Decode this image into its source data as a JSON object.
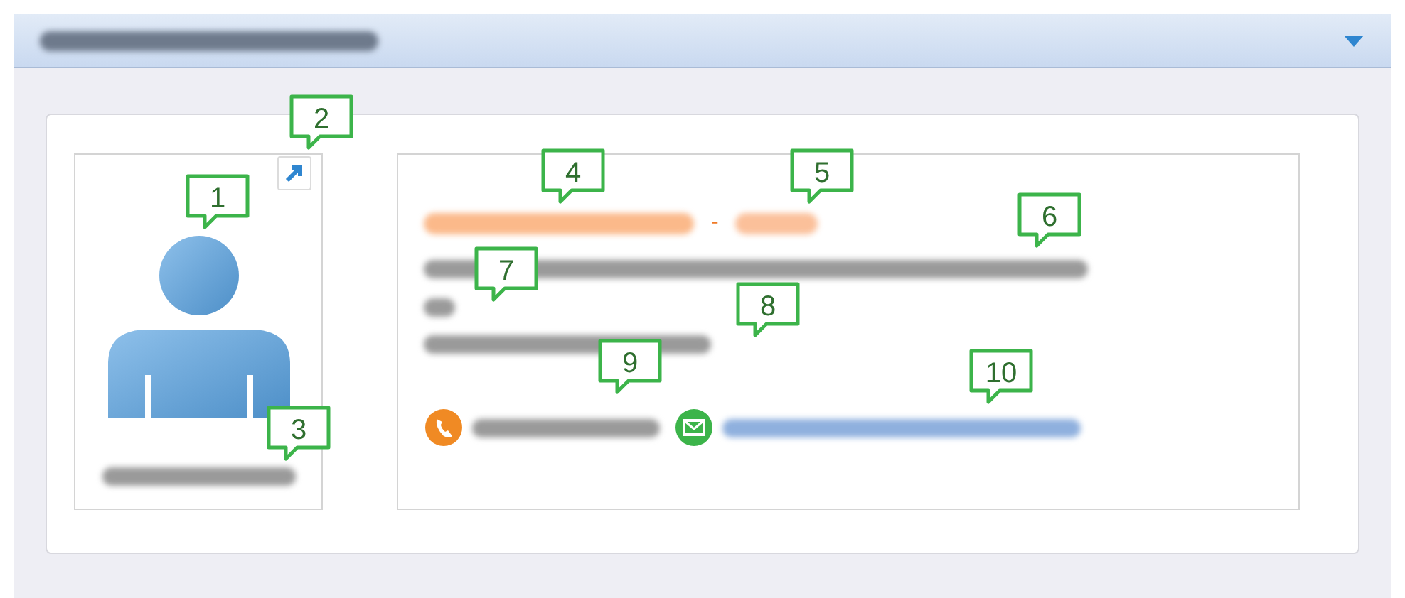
{
  "contact": {
    "separator": "-"
  },
  "callouts": [
    {
      "label": "1"
    },
    {
      "label": "2"
    },
    {
      "label": "3"
    },
    {
      "label": "4"
    },
    {
      "label": "5"
    },
    {
      "label": "6"
    },
    {
      "label": "7"
    },
    {
      "label": "8"
    },
    {
      "label": "9"
    },
    {
      "label": "10"
    }
  ]
}
